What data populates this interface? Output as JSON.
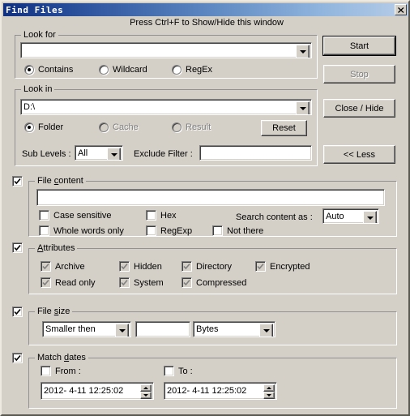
{
  "window": {
    "title": "Find Files",
    "close_icon": "close-icon",
    "hint": "Press Ctrl+F to Show/Hide this window"
  },
  "look_for": {
    "legend": "Look for",
    "combo_value": "",
    "combo_placeholder": "",
    "modes": [
      {
        "label": "Contains",
        "checked": true
      },
      {
        "label": "Wildcard",
        "checked": false
      },
      {
        "label": "RegEx",
        "checked": false
      }
    ]
  },
  "look_in": {
    "legend": "Look in",
    "combo_value": "D:\\",
    "sources": [
      {
        "label": "Folder",
        "checked": true,
        "disabled": false
      },
      {
        "label": "Cache",
        "checked": false,
        "disabled": true
      },
      {
        "label": "Result",
        "checked": false,
        "disabled": true
      }
    ],
    "reset_label": "Reset",
    "sub_levels_label": "Sub Levels :",
    "sub_levels_value": "All",
    "exclude_filter_label": "Exclude Filter :",
    "exclude_filter_value": ""
  },
  "actions": {
    "start_label": "Start",
    "stop_label": "Stop",
    "close_hide_label": "Close / Hide",
    "less_label": "<< Less",
    "stop_disabled": true
  },
  "file_content": {
    "enabled": true,
    "legend_pre": "File ",
    "legend_accel": "c",
    "legend_post": "ontent",
    "text_value": "",
    "options": [
      {
        "label": "Case sensitive",
        "checked": false
      },
      {
        "label": "Whole words only",
        "checked": false
      },
      {
        "label": "Hex",
        "checked": false
      },
      {
        "label": "RegExp",
        "checked": false
      },
      {
        "label": "Not there",
        "checked": false
      }
    ],
    "search_as_label": "Search content as :",
    "search_as_value": "Auto"
  },
  "attributes": {
    "enabled": true,
    "legend_pre": "",
    "legend_accel": "A",
    "legend_post": "ttributes",
    "items": [
      {
        "label": "Archive",
        "checked": true,
        "grayed": true
      },
      {
        "label": "Hidden",
        "checked": true,
        "grayed": true
      },
      {
        "label": "Directory",
        "checked": true,
        "grayed": true
      },
      {
        "label": "Encrypted",
        "checked": true,
        "grayed": true
      },
      {
        "label": "Read only",
        "checked": true,
        "grayed": true
      },
      {
        "label": "System",
        "checked": true,
        "grayed": true
      },
      {
        "label": "Compressed",
        "checked": true,
        "grayed": true
      }
    ]
  },
  "file_size": {
    "enabled": true,
    "legend_pre": "File ",
    "legend_accel": "s",
    "legend_post": "ize",
    "comparison_value": "Smaller then",
    "amount_value": "",
    "unit_value": "Bytes"
  },
  "match_dates": {
    "enabled": true,
    "legend_pre": "Match ",
    "legend_accel": "d",
    "legend_post": "ates",
    "from_label": "From :",
    "from_checked": false,
    "from_value": "2012-  4-11 12:25:02",
    "to_label": "To :",
    "to_checked": false,
    "to_value": "2012-  4-11 12:25:02"
  },
  "colors": {
    "face": "#d4d0c8",
    "title_start": "#103080",
    "title_end": "#b7cde8",
    "disabled_text": "#808080"
  }
}
